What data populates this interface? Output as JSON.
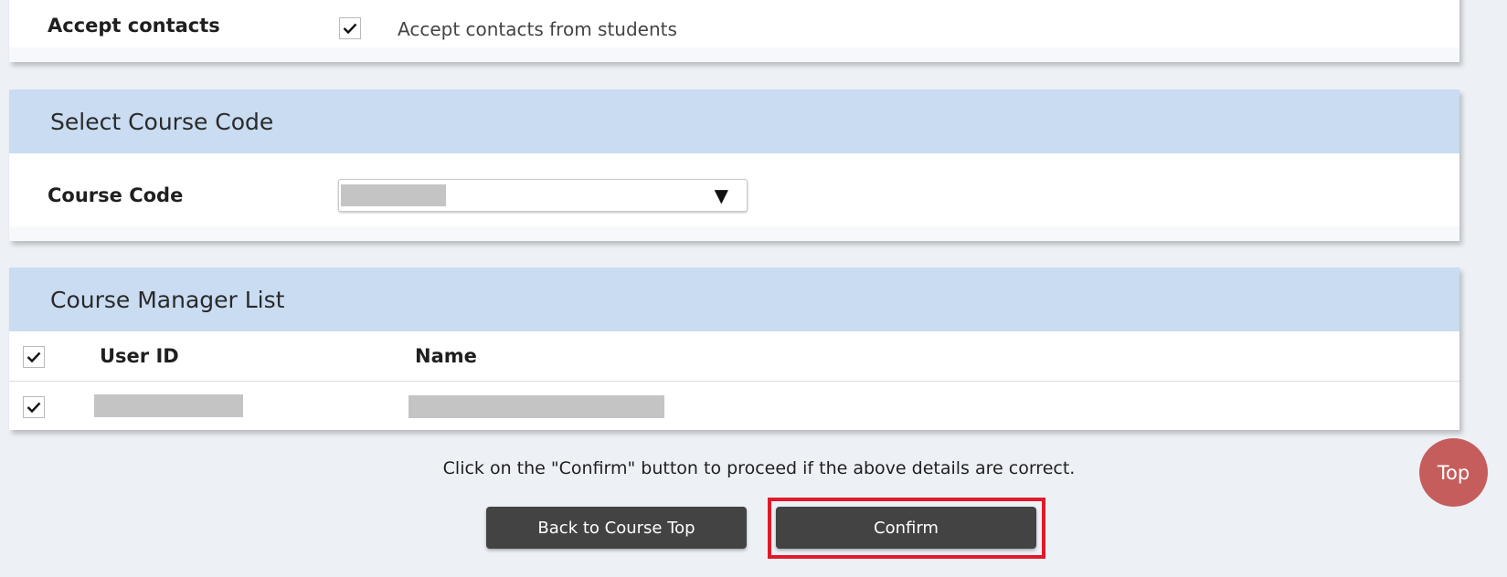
{
  "contact_section": {
    "label": "Accept contacts",
    "checkbox_checked": true,
    "checkbox_text": "Accept contacts from students"
  },
  "course_code_section": {
    "title": "Select Course Code",
    "field_label": "Course Code",
    "selected_value": "",
    "arrow_glyph": "▼"
  },
  "manager_list": {
    "title": "Course Manager List",
    "columns": [
      "User ID",
      "Name"
    ],
    "select_all_checked": true,
    "rows": [
      {
        "checked": true,
        "user_id": "",
        "name": ""
      }
    ]
  },
  "footer": {
    "notice": "Click on the \"Confirm\" button to proceed if the above details are correct.",
    "back_button": "Back to Course Top",
    "confirm_button": "Confirm",
    "top_button": "Top"
  },
  "colors": {
    "page_background": "#edf1f6",
    "section_header": "#c9dcf1",
    "button_dark": "#434343",
    "highlight_red": "#e01a2a",
    "top_button": "#c65d5d"
  }
}
